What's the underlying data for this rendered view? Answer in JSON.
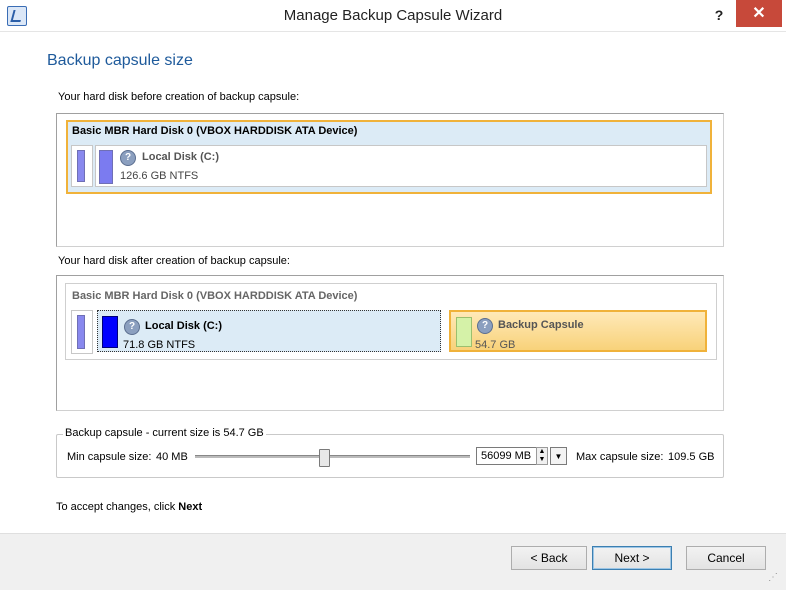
{
  "window": {
    "title": "Manage Backup Capsule Wizard",
    "help": "?",
    "close": "✕"
  },
  "page": {
    "title": "Backup capsule size"
  },
  "before": {
    "caption": "Your hard disk before creation of backup capsule:",
    "disk_name": "Basic MBR Hard Disk 0 (VBOX HARDDISK ATA Device)",
    "partition": {
      "name": "Local Disk (C:)",
      "size": "126.6 GB NTFS"
    }
  },
  "after": {
    "caption": "Your hard disk after creation of backup capsule:",
    "disk_name": "Basic MBR Hard Disk 0 (VBOX HARDDISK ATA Device)",
    "partition": {
      "name": "Local Disk (C:)",
      "size": "71.8 GB NTFS"
    },
    "capsule": {
      "name": "Backup Capsule",
      "size": "54.7 GB"
    }
  },
  "capsule_group": {
    "legend": "Backup capsule - current size is 54.7 GB",
    "min_label": "Min capsule size:",
    "min_value": "40 MB",
    "input_value": "56099 MB",
    "max_label": "Max capsule size:",
    "max_value": "109.5 GB",
    "slider_level": 0.47
  },
  "hint": {
    "prefix": "To accept changes, click ",
    "bold": "Next"
  },
  "buttons": {
    "back": "< Back",
    "next": "Next >",
    "cancel": "Cancel"
  },
  "icons": {
    "question": "?",
    "spin_up": "▲",
    "spin_down": "▼",
    "dropdown": "▼",
    "grip": "⋰"
  },
  "colors": {
    "accent": "#1e5a9b",
    "selection_border": "#f0b23a",
    "partition_blue": "#0000ff",
    "capsule_green": "#d5f2a8",
    "close_red": "#c7493a"
  }
}
